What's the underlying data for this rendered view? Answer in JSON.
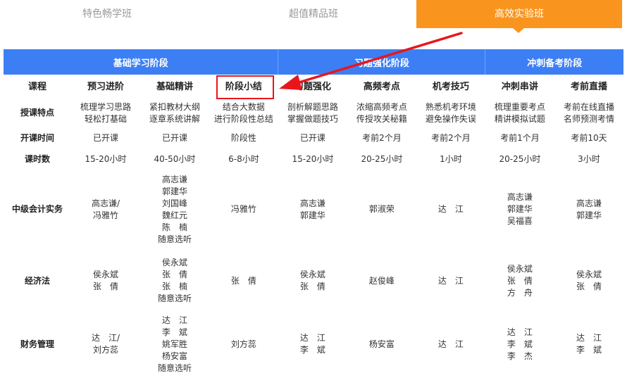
{
  "tabs": [
    {
      "label": "特色畅学班"
    },
    {
      "label": "超值精品班"
    },
    {
      "label": "高效实验班"
    }
  ],
  "colors": {
    "accent_orange": "#f9951f",
    "header_blue": "#3c7ff5",
    "highlight_red": "#e8161b"
  },
  "stages": [
    {
      "label": "基础学习阶段"
    },
    {
      "label": "习题强化阶段"
    },
    {
      "label": "冲刺备考阶段"
    }
  ],
  "header_row": [
    "课程",
    "预习进阶",
    "基础精讲",
    "阶段小结",
    "习题强化",
    "高频考点",
    "机考技巧",
    "冲刺串讲",
    "考前直播"
  ],
  "rows": [
    {
      "label": "授课特点",
      "cells": [
        "梳理学习思路\n轻松打基础",
        "紧扣教材大纲\n逐章系统讲解",
        "结合大数据\n进行阶段性总结",
        "剖析解题思路\n掌握做题技巧",
        "浓缩高频考点\n传授攻关秘籍",
        "熟悉机考环境\n避免操作失误",
        "梳理重要考点\n精讲模拟试题",
        "考前在线直播\n名师预测考情"
      ]
    },
    {
      "label": "开课时间",
      "cells": [
        "已开课",
        "已开课",
        "阶段性",
        "已开课",
        "考前2个月",
        "考前2个月",
        "考前1个月",
        "考前10天"
      ]
    },
    {
      "label": "课时数",
      "cells": [
        "15-20小时",
        "40-50小时",
        "6-8小时",
        "15-20小时",
        "20-25小时",
        "1小时",
        "20-25小时",
        "3小时"
      ]
    },
    {
      "label": "中级会计实务",
      "cells": [
        "高志谦/\n冯雅竹",
        "高志谦\n郭建华\n刘国峰\n魏红元\n陈　楠\n随意选听",
        "冯雅竹",
        "高志谦\n郭建华",
        "郭淑荣",
        "达　江",
        "高志谦\n郭建华\n吴福喜",
        "高志谦\n郭建华"
      ]
    },
    {
      "label": "经济法",
      "cells": [
        "侯永斌\n张　倩",
        "侯永斌\n张　倩\n张　楠\n随意选听",
        "张　倩",
        "侯永斌\n张　倩",
        "赵俊峰",
        "达　江",
        "侯永斌\n张　倩\n方　舟",
        "侯永斌\n张　倩"
      ]
    },
    {
      "label": "财务管理",
      "cells": [
        "达　江/\n刘方蕊",
        "达　江\n李　斌\n姚军胜\n杨安富\n随意选听",
        "刘方蕊",
        "达　江\n李　斌",
        "杨安富",
        "达　江",
        "达　江\n李　斌\n李　杰",
        "达　江\n李　斌"
      ]
    }
  ]
}
